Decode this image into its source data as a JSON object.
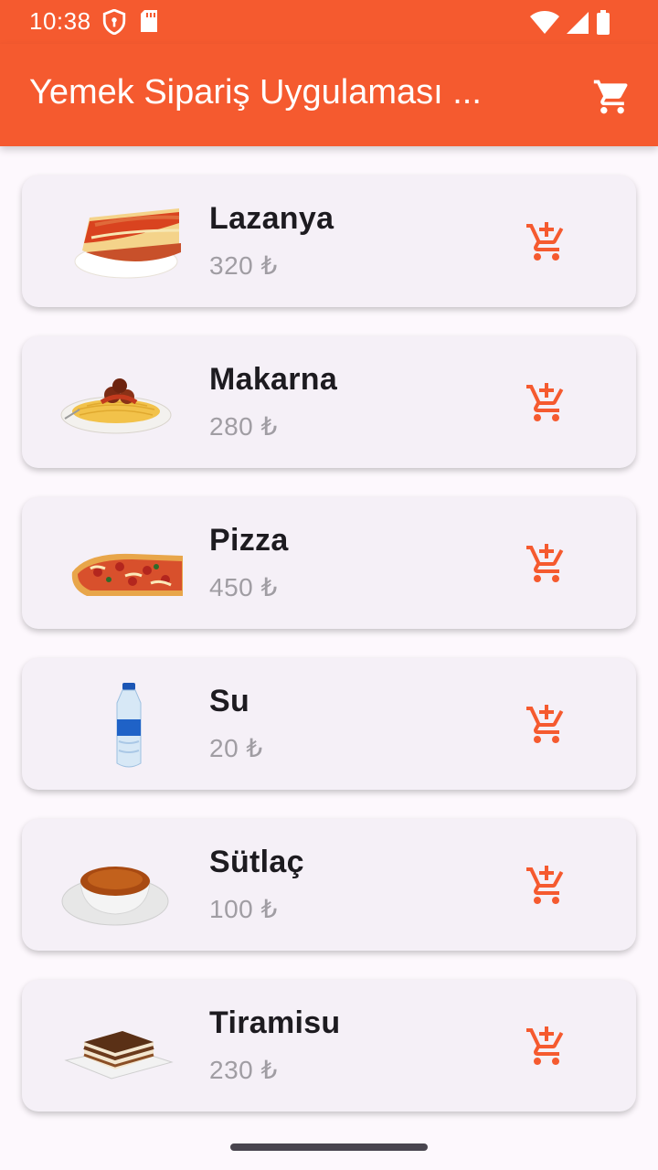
{
  "status_bar": {
    "time": "10:38"
  },
  "app_bar": {
    "title": "Yemek Sipariş Uygulaması ...",
    "cart_icon": "shopping-cart-icon"
  },
  "colors": {
    "accent": "#f55a2f",
    "card": "#f5f0f7",
    "price": "#a09da3"
  },
  "items": [
    {
      "name": "Lazanya",
      "price": "320 ₺",
      "image": "lasagna"
    },
    {
      "name": "Makarna",
      "price": "280 ₺",
      "image": "spaghetti"
    },
    {
      "name": "Pizza",
      "price": "450 ₺",
      "image": "pizza"
    },
    {
      "name": "Su",
      "price": "20 ₺",
      "image": "water-bottle"
    },
    {
      "name": "Sütlaç",
      "price": "100 ₺",
      "image": "rice-pudding"
    },
    {
      "name": "Tiramisu",
      "price": "230 ₺",
      "image": "tiramisu"
    }
  ]
}
